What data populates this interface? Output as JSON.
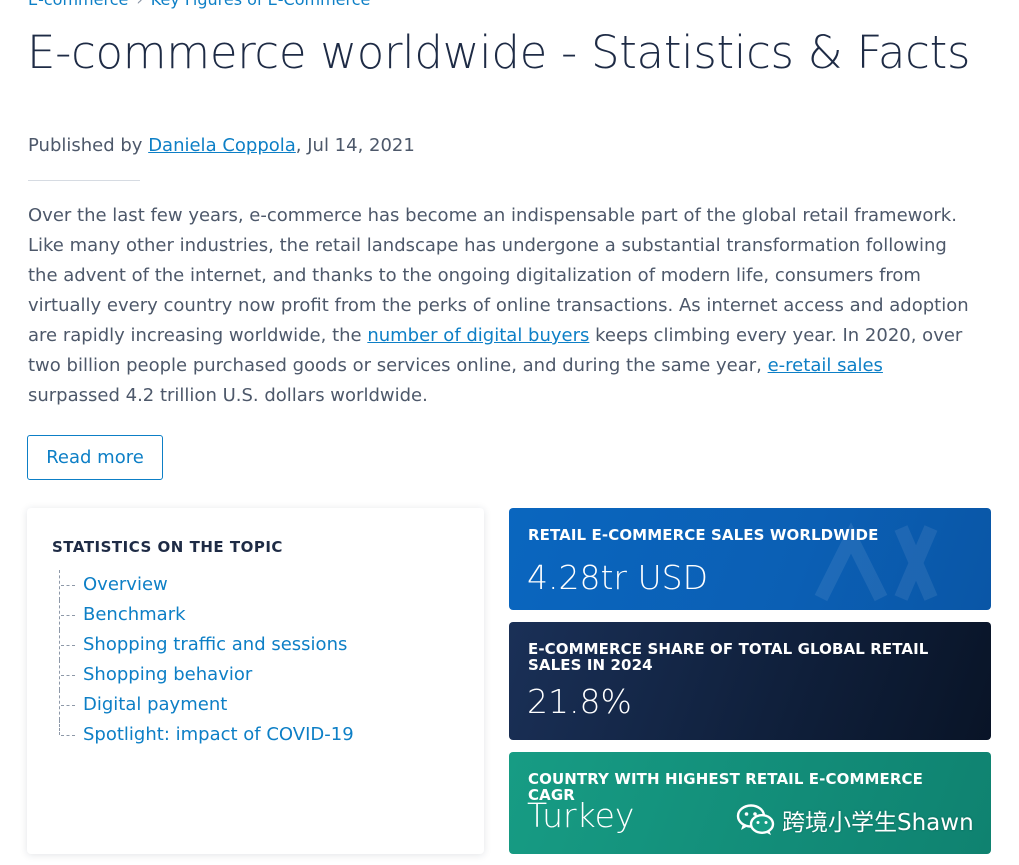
{
  "breadcrumb": {
    "item1": "E-commerce",
    "sep": "›",
    "item2": "Key Figures of E-Commerce"
  },
  "title": "E-commerce worldwide - Statistics & Facts",
  "byline": {
    "prefix": "Published by ",
    "author": "Daniela Coppola",
    "date": ", Jul 14, 2021"
  },
  "intro": {
    "part1": "Over the last few years, e-commerce has become an indispensable part of the global retail framework. Like many other industries, the retail landscape has undergone a substantial transformation following the advent of the internet, and thanks to the ongoing digitalization of modern life, consumers from virtually every country now profit from the perks of online transactions. As internet access and adoption are rapidly increasing worldwide, the ",
    "link1": "number of digital buyers",
    "part2": " keeps climbing every year. In 2020, over two billion people purchased goods or services online, and during the same year, ",
    "link2": "e-retail sales",
    "part3": " surpassed 4.2 trillion U.S. dollars worldwide."
  },
  "read_more": "Read more",
  "topics": {
    "heading": "STATISTICS ON THE TOPIC",
    "items": [
      "Overview",
      "Benchmark",
      "Shopping traffic and sessions",
      "Shopping behavior",
      "Digital payment",
      "Spotlight: impact of COVID-19"
    ]
  },
  "stats": [
    {
      "label": "RETAIL E-COMMERCE SALES WORLDWIDE",
      "value": "4.28tr USD",
      "color": "#0a62b9"
    },
    {
      "label": "E-COMMERCE SHARE OF TOTAL GLOBAL RETAIL SALES IN 2024",
      "value": "21.8%",
      "color": "#13254a"
    },
    {
      "label": "COUNTRY WITH HIGHEST RETAIL E-COMMERCE CAGR",
      "value": "Turkey",
      "color": "#14937e"
    }
  ],
  "watermark": {
    "icon": "wechat-icon",
    "text": "跨境小学生Shawn"
  },
  "colors": {
    "link": "#0d7fc6",
    "title": "#1e2b45",
    "text": "#4d586a"
  }
}
